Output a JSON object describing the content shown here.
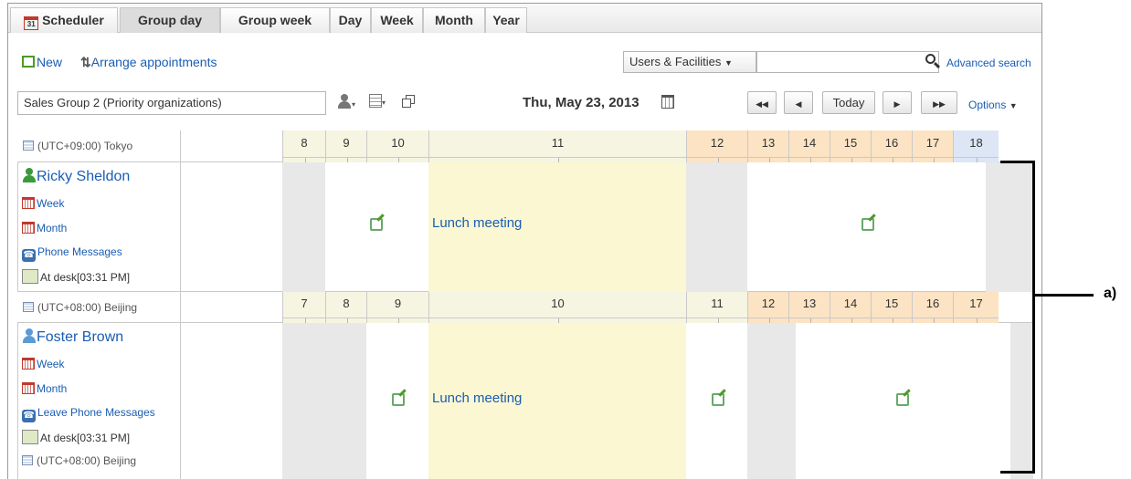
{
  "tabs": [
    {
      "label": "Scheduler",
      "icon": "calendar-31-icon",
      "active": false
    },
    {
      "label": "Group day",
      "active": true
    },
    {
      "label": "Group week",
      "active": false
    },
    {
      "label": "Day",
      "active": false
    },
    {
      "label": "Week",
      "active": false
    },
    {
      "label": "Month",
      "active": false
    },
    {
      "label": "Year",
      "active": false
    }
  ],
  "toolbar": {
    "new_label": "New",
    "arrange_label": "Arrange appointments",
    "search_scope": "Users & Facilities",
    "search_value": "",
    "advanced_search": "Advanced search"
  },
  "nav": {
    "group_select": "Sales Group 2 (Priority organizations)",
    "date": "Thu, May 23, 2013",
    "today": "Today",
    "options": "Options"
  },
  "timezones": [
    {
      "label": "(UTC+09:00) Tokyo",
      "hours": [
        "8",
        "9",
        "10",
        "11",
        "12",
        "13",
        "14",
        "15",
        "16",
        "17",
        "18"
      ]
    },
    {
      "label": "(UTC+08:00) Beijing",
      "hours": [
        "7",
        "8",
        "9",
        "10",
        "11",
        "12",
        "13",
        "14",
        "15",
        "16",
        "17"
      ]
    }
  ],
  "people": [
    {
      "name": "Ricky Sheldon",
      "links": [
        "Week",
        "Month",
        "Phone Messages"
      ],
      "status": "At desk[03:31 PM]",
      "event": "Lunch meeting"
    },
    {
      "name": "Foster Brown",
      "links": [
        "Week",
        "Month",
        "Leave Phone Messages"
      ],
      "status": "At desk[03:31 PM]",
      "timezone": "(UTC+08:00) Beijing",
      "event": "Lunch meeting"
    }
  ],
  "annotation": "a)",
  "colors": {
    "link": "#1a5db3",
    "lunch_bg": "#faf7d2",
    "worktime_bg": "#fbe3c4",
    "offtime_bg": "#f5f5e2",
    "current_hour": "#dde6f5",
    "green_icon": "#4c9a2a"
  }
}
